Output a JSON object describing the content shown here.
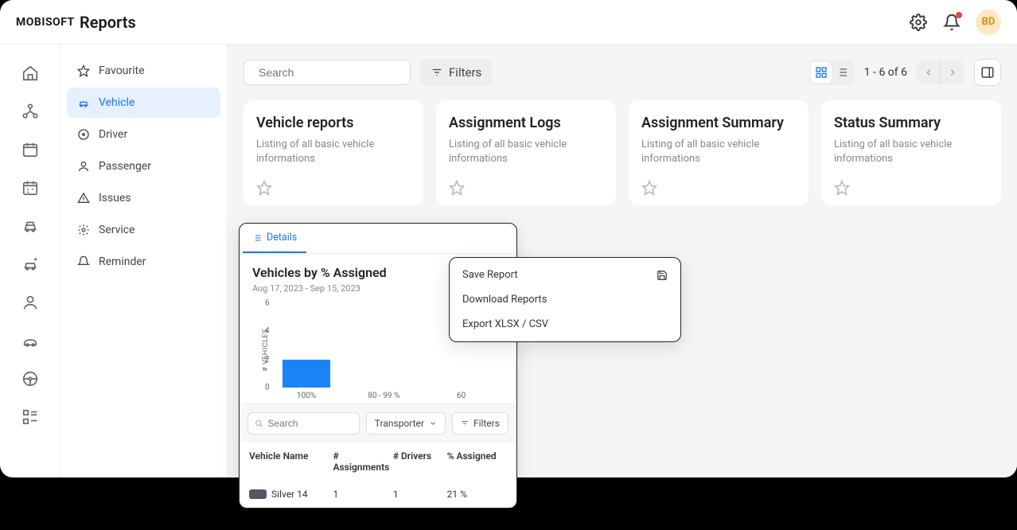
{
  "header": {
    "logo": "MOBISOFT",
    "title": "Reports",
    "avatar": "BD"
  },
  "sidebar": {
    "items": [
      {
        "label": "Favourite"
      },
      {
        "label": "Vehicle"
      },
      {
        "label": "Driver"
      },
      {
        "label": "Passenger"
      },
      {
        "label": "Issues"
      },
      {
        "label": "Service"
      },
      {
        "label": "Reminder"
      }
    ]
  },
  "toolbar": {
    "search_placeholder": "Search",
    "filters_label": "Filters",
    "pager_text": "1 - 6 of 6"
  },
  "cards": [
    {
      "title": "Vehicle reports",
      "desc": "Listing of all basic vehicle informations"
    },
    {
      "title": "Assignment Logs",
      "desc": "Listing of all basic vehicle informations"
    },
    {
      "title": "Assignment Summary",
      "desc": "Listing of all basic vehicle informations"
    },
    {
      "title": "Status Summary",
      "desc": "Listing of all basic vehicle informations"
    }
  ],
  "detail": {
    "tab_label": "Details",
    "chart_title": "Vehicles by % Assigned",
    "chart_sub": "Aug 17, 2023 - Sep 15, 2023",
    "mini_search_placeholder": "Search",
    "transporter_label": "Transporter",
    "filters_label": "Filters",
    "cols": {
      "c1": "Vehicle Name",
      "c2": "# Assignments",
      "c3": "# Drivers",
      "c4": "% Assigned"
    },
    "row": {
      "name": "Silver 14",
      "assign": "1",
      "drivers": "1",
      "pct": "21 %"
    }
  },
  "ctx": {
    "save": "Save Report",
    "download": "Download Reports",
    "export": "Export XLSX / CSV"
  },
  "chart_data": {
    "type": "bar",
    "title": "Vehicles by % Assigned",
    "ylabel": "# VEHICLES",
    "categories": [
      "100%",
      "80 - 99 %",
      "60"
    ],
    "values": [
      2,
      0,
      0
    ],
    "yticks": [
      0,
      2,
      4,
      6
    ],
    "ylim": [
      0,
      6
    ]
  }
}
